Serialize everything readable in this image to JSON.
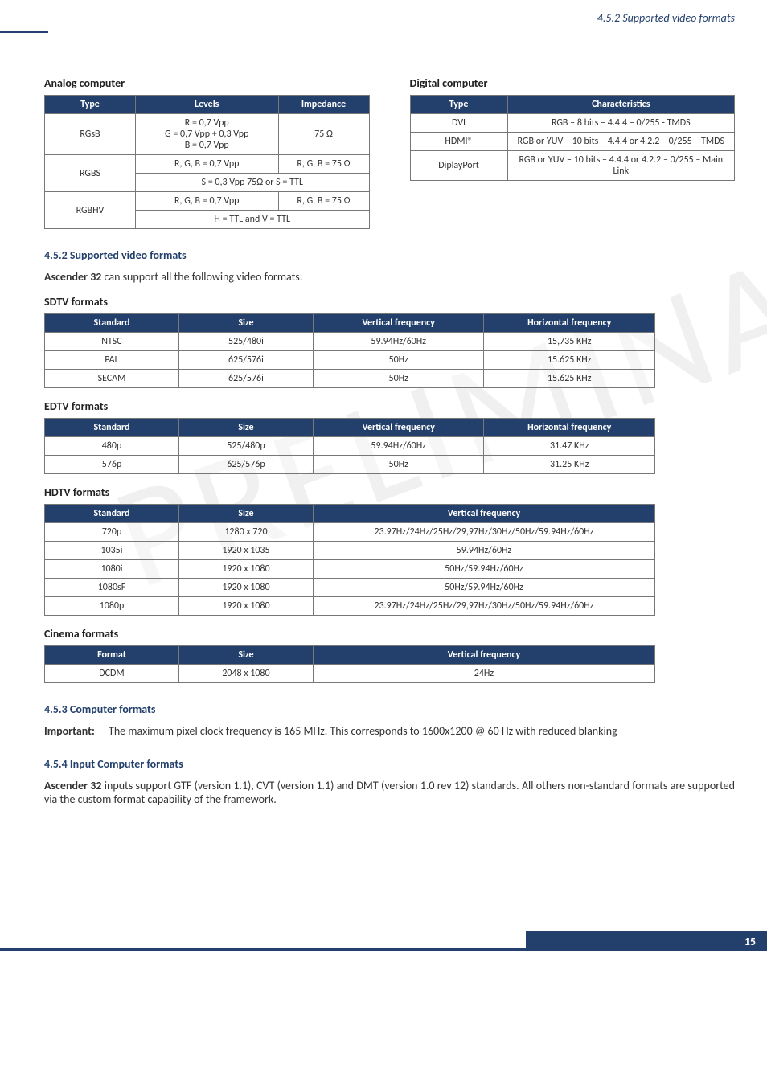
{
  "header": {
    "section_ref": "4.5.2 Supported video formats"
  },
  "watermark": "PRELIMINARY",
  "analog": {
    "title": "Analog computer",
    "head": [
      "Type",
      "Levels",
      "Impedance"
    ],
    "r1": {
      "type": "RGsB",
      "levels": "R = 0,7 Vpp\nG = 0,7 Vpp + 0,3 Vpp\nB = 0,7 Vpp",
      "imp": "75 Ω"
    },
    "r2": {
      "type": "RGBS",
      "l1": "R, G, B = 0,7 Vpp",
      "i1": "R, G, B = 75 Ω",
      "s": "S = 0,3 Vpp 75Ω or S = TTL"
    },
    "r3": {
      "type": "RGBHV",
      "l1": "R, G, B = 0,7 Vpp",
      "i1": "R, G, B = 75 Ω",
      "hv": "H = TTL and V = TTL"
    }
  },
  "digital": {
    "title": "Digital computer",
    "head": [
      "Type",
      "Characteristics"
    ],
    "rows": [
      {
        "t": "DVI",
        "c": "RGB – 8 bits – 4.4.4 – 0/255 - TMDS"
      },
      {
        "t": "HDMI®",
        "c": "RGB or YUV – 10 bits – 4.4.4 or 4.2.2 – 0/255 – TMDS"
      },
      {
        "t": "DiplayPort",
        "c": "RGB or YUV – 10 bits – 4.4.4 or 4.2.2 – 0/255 – Main Link"
      }
    ]
  },
  "s452": {
    "heading": "4.5.2 Supported video formats",
    "intro_bold": "Ascender 32",
    "intro_rest": " can support all the following video formats:"
  },
  "sdtv": {
    "title": "SDTV formats",
    "head": [
      "Standard",
      "Size",
      "Vertical frequency",
      "Horizontal frequency"
    ],
    "rows": [
      [
        "NTSC",
        "525/480i",
        "59.94Hz/60Hz",
        "15,735 KHz"
      ],
      [
        "PAL",
        "625/576i",
        "50Hz",
        "15.625 KHz"
      ],
      [
        "SECAM",
        "625/576i",
        "50Hz",
        "15.625 KHz"
      ]
    ]
  },
  "edtv": {
    "title": "EDTV formats",
    "head": [
      "Standard",
      "Size",
      "Vertical frequency",
      "Horizontal frequency"
    ],
    "rows": [
      [
        "480p",
        "525/480p",
        "59.94Hz/60Hz",
        "31.47 KHz"
      ],
      [
        "576p",
        "625/576p",
        "50Hz",
        "31.25 KHz"
      ]
    ]
  },
  "hdtv": {
    "title": "HDTV formats",
    "head": [
      "Standard",
      "Size",
      "Vertical frequency"
    ],
    "rows": [
      [
        "720p",
        "1280 x 720",
        "23.97Hz/24Hz/25Hz/29,97Hz/30Hz/50Hz/59.94Hz/60Hz"
      ],
      [
        "1035i",
        "1920 x 1035",
        "59.94Hz/60Hz"
      ],
      [
        "1080i",
        "1920 x 1080",
        "50Hz/59.94Hz/60Hz"
      ],
      [
        "1080sF",
        "1920 x 1080",
        "50Hz/59.94Hz/60Hz"
      ],
      [
        "1080p",
        "1920 x 1080",
        "23.97Hz/24Hz/25Hz/29,97Hz/30Hz/50Hz/59.94Hz/60Hz"
      ]
    ]
  },
  "cinema": {
    "title": "Cinema formats",
    "head": [
      "Format",
      "Size",
      "Vertical frequency"
    ],
    "rows": [
      [
        "DCDM",
        "2048 x 1080",
        "24Hz"
      ]
    ]
  },
  "s453": {
    "heading": "4.5.3 Computer formats",
    "label": "Important:",
    "text": " The maximum pixel clock frequency is 165 MHz. This corresponds to 1600x1200 @ 60 Hz with reduced blanking"
  },
  "s454": {
    "heading": "4.5.4 Input Computer formats",
    "bold": "Ascender 32",
    "text": " inputs support GTF (version 1.1), CVT (version 1.1) and DMT (version 1.0 rev 12) standards. All others non-standard formats are supported via the custom format capability of the framework."
  },
  "footer": {
    "page": "15"
  }
}
